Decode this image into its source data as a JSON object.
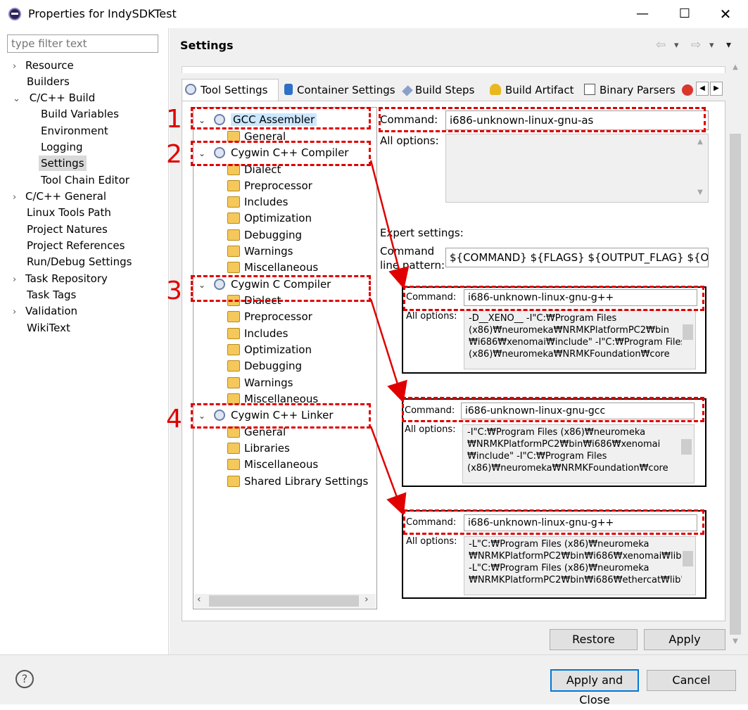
{
  "window": {
    "title": "Properties for IndySDKTest",
    "minimize": "—",
    "maximize": "☐",
    "close": "✕"
  },
  "filter": {
    "placeholder": "type filter text"
  },
  "nav": {
    "items": [
      {
        "label": "Resource",
        "chev": "›"
      },
      {
        "label": "Builders",
        "chev": ""
      },
      {
        "label": "C/C++ Build",
        "chev": "⌄"
      },
      {
        "label": "Build Variables",
        "chev": ""
      },
      {
        "label": "Environment",
        "chev": ""
      },
      {
        "label": "Logging",
        "chev": ""
      },
      {
        "label": "Settings",
        "chev": ""
      },
      {
        "label": "Tool Chain Editor",
        "chev": ""
      },
      {
        "label": "C/C++ General",
        "chev": "›"
      },
      {
        "label": "Linux Tools Path",
        "chev": ""
      },
      {
        "label": "Project Natures",
        "chev": ""
      },
      {
        "label": "Project References",
        "chev": ""
      },
      {
        "label": "Run/Debug Settings",
        "chev": ""
      },
      {
        "label": "Task Repository",
        "chev": "›"
      },
      {
        "label": "Task Tags",
        "chev": ""
      },
      {
        "label": "Validation",
        "chev": "›"
      },
      {
        "label": "WikiText",
        "chev": ""
      }
    ]
  },
  "header": {
    "title": "Settings",
    "back": "⇦",
    "forward": "⇨",
    "menu": "▾"
  },
  "tabs": [
    {
      "label": "Tool Settings"
    },
    {
      "label": "Container Settings"
    },
    {
      "label": "Build Steps"
    },
    {
      "label": "Build Artifact"
    },
    {
      "label": "Binary Parsers"
    }
  ],
  "tab_scroll": {
    "left": "◀",
    "right": "▶"
  },
  "tree": {
    "sections": [
      {
        "label": "GCC Assembler",
        "children": [
          "General"
        ]
      },
      {
        "label": "Cygwin C++ Compiler",
        "children": [
          "Dialect",
          "Preprocessor",
          "Includes",
          "Optimization",
          "Debugging",
          "Warnings",
          "Miscellaneous"
        ]
      },
      {
        "label": "Cygwin C Compiler",
        "children": [
          "Dialect",
          "Preprocessor",
          "Includes",
          "Optimization",
          "Debugging",
          "Warnings",
          "Miscellaneous"
        ]
      },
      {
        "label": "Cygwin C++ Linker",
        "children": [
          "General",
          "Libraries",
          "Miscellaneous",
          "Shared Library Settings"
        ]
      }
    ],
    "scroll_left": "‹",
    "scroll_right": "›"
  },
  "form": {
    "command_label": "Command:",
    "command_value": "i686-unknown-linux-gnu-as",
    "all_options_label": "All options:",
    "expert_label": "Expert settings:",
    "pattern_label_1": "Command",
    "pattern_label_2": "line pattern:",
    "pattern_value": "${COMMAND} ${FLAGS} ${OUTPUT_FLAG} ${OUTPUT_PREFIX}"
  },
  "annotations": {
    "numbers": [
      "1",
      "2",
      "3",
      "4"
    ],
    "panels": [
      {
        "command_label": "Command:",
        "command_value": "i686-unknown-linux-gnu-g++",
        "options_label": "All options:",
        "options_lines": [
          "-D__XENO__ -I\"C:₩Program Files",
          "(x86)₩neuromeka₩NRMKPlatformPC2₩bin",
          "₩i686₩xenomai₩include\" -I\"C:₩Program Files",
          "(x86)₩neuromeka₩NRMKFoundation₩core"
        ]
      },
      {
        "command_label": "Command:",
        "command_value": "i686-unknown-linux-gnu-gcc",
        "options_label": "All options:",
        "options_lines": [
          "-I\"C:₩Program Files (x86)₩neuromeka",
          "₩NRMKPlatformPC2₩bin₩i686₩xenomai",
          "₩include\" -I\"C:₩Program Files",
          "(x86)₩neuromeka₩NRMKFoundation₩core"
        ]
      },
      {
        "command_label": "Command:",
        "command_value": "i686-unknown-linux-gnu-g++",
        "options_label": "All options:",
        "options_lines": [
          "-L\"C:₩Program Files (x86)₩neuromeka",
          "₩NRMKPlatformPC2₩bin₩i686₩xenomai₩lib\"",
          "-L\"C:₩Program Files (x86)₩neuromeka",
          "₩NRMKPlatformPC2₩bin₩i686₩ethercat₩lib\""
        ]
      }
    ]
  },
  "buttons": {
    "restore_defaults": "Restore Defaults",
    "apply": "Apply",
    "apply_and_close": "Apply and Close",
    "cancel": "Cancel",
    "help": "?"
  },
  "colors": {
    "annotation_red": "#e00000",
    "accent_blue": "#0078d7",
    "selection_bg": "#d9d9d9",
    "tree_header_bg": "#cce8ff"
  }
}
